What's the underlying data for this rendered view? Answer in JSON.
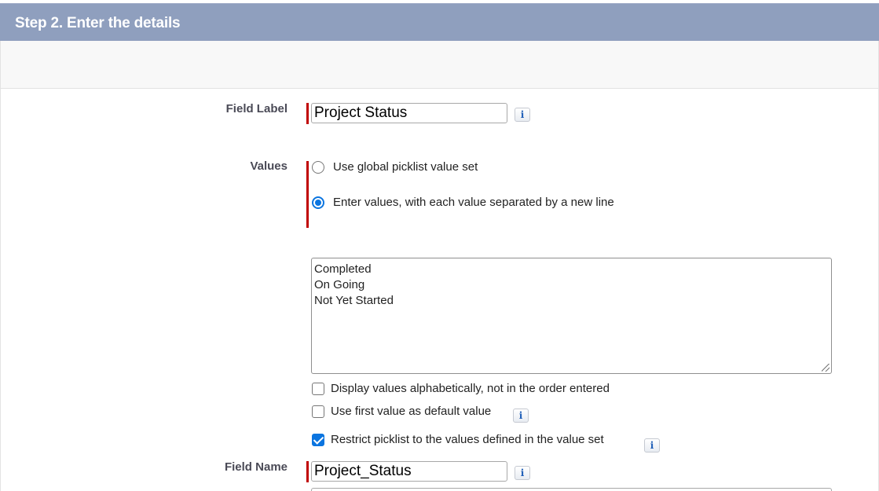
{
  "header": {
    "title": "Step 2. Enter the details"
  },
  "form": {
    "field_label": {
      "label": "Field Label",
      "value": "Project Status"
    },
    "values": {
      "label": "Values",
      "options": [
        {
          "label": "Use global picklist value set",
          "selected": false
        },
        {
          "label": "Enter values, with each value separated by a new line",
          "selected": true
        }
      ],
      "entries": [
        "Completed",
        "On Going",
        "Not Yet Started"
      ]
    },
    "checkboxes": [
      {
        "label": "Display values alphabetically, not in the order entered",
        "checked": false
      },
      {
        "label": "Use first value as default value",
        "checked": false
      },
      {
        "label": "Restrict picklist to the values defined in the value set",
        "checked": true
      }
    ],
    "field_name": {
      "label": "Field Name",
      "value": "Project_Status"
    },
    "info_glyph": "i"
  },
  "icons": {
    "info": "info-icon",
    "resize": "resize-grip-icon"
  },
  "colors": {
    "header_bg": "#8f9fbe",
    "required_marker": "#c00000",
    "accent": "#0b75e0"
  }
}
